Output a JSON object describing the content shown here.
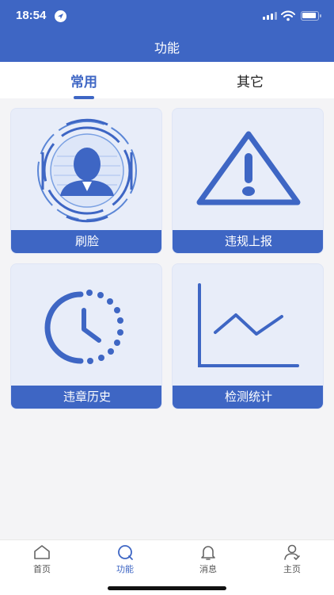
{
  "status": {
    "time": "18:54"
  },
  "header": {
    "title": "功能"
  },
  "tabs": [
    {
      "label": "常用",
      "active": true
    },
    {
      "label": "其它",
      "active": false
    }
  ],
  "cards": [
    {
      "label": "刷脸",
      "icon": "face-scan-icon"
    },
    {
      "label": "违规上报",
      "icon": "warning-icon"
    },
    {
      "label": "违章历史",
      "icon": "clock-icon"
    },
    {
      "label": "检测统计",
      "icon": "line-chart-icon"
    }
  ],
  "tabbar": [
    {
      "label": "首页",
      "icon": "home-icon"
    },
    {
      "label": "功能",
      "icon": "chat-icon",
      "active": true
    },
    {
      "label": "消息",
      "icon": "bell-icon"
    },
    {
      "label": "主页",
      "icon": "user-icon"
    }
  ],
  "colors": {
    "primary": "#3e66c4",
    "card_bg": "#e8edf9",
    "page_bg": "#f4f4f6"
  }
}
